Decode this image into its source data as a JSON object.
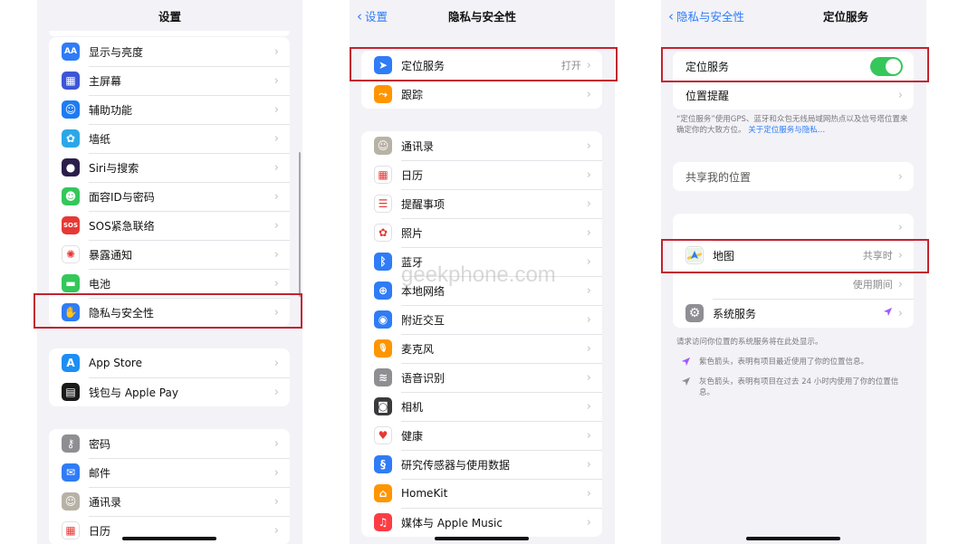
{
  "panel1": {
    "title": "设置",
    "group1": [
      {
        "label": "显示与亮度",
        "icon": "display-brightness-icon",
        "glyph": "AA",
        "color": "#2f7cf6"
      },
      {
        "label": "主屏幕",
        "icon": "home-screen-icon",
        "glyph": "▦",
        "color": "#3d56d6"
      },
      {
        "label": "辅助功能",
        "icon": "accessibility-icon",
        "glyph": "☺",
        "color": "#1e7bf2"
      },
      {
        "label": "墙纸",
        "icon": "wallpaper-icon",
        "glyph": "✿",
        "color": "#2ba7e8"
      },
      {
        "label": "Siri与搜索",
        "icon": "siri-icon",
        "glyph": "●",
        "color": "#2b1f4a"
      },
      {
        "label": "面容ID与密码",
        "icon": "face-id-icon",
        "glyph": "☻",
        "color": "#34c759"
      },
      {
        "label": "SOS紧急联络",
        "icon": "sos-icon",
        "glyph": "SOS",
        "color": "#e53935"
      },
      {
        "label": "暴露通知",
        "icon": "exposure-notification-icon",
        "glyph": "✺",
        "color": "#ffffff"
      },
      {
        "label": "电池",
        "icon": "battery-icon",
        "glyph": "▬",
        "color": "#34c759"
      },
      {
        "label": "隐私与安全性",
        "icon": "privacy-hand-icon",
        "glyph": "✋",
        "color": "#2f7cf6"
      }
    ],
    "group2": [
      {
        "label": "App Store",
        "icon": "app-store-icon",
        "glyph": "A",
        "color": "#1c8ef5"
      },
      {
        "label": "钱包与 Apple Pay",
        "icon": "wallet-icon",
        "glyph": "▤",
        "color": "#1a1a1a"
      }
    ],
    "group3": [
      {
        "label": "密码",
        "icon": "key-icon",
        "glyph": "⚷",
        "color": "#8e8e93"
      },
      {
        "label": "邮件",
        "icon": "mail-icon",
        "glyph": "✉",
        "color": "#2f7cf6"
      },
      {
        "label": "通讯录",
        "icon": "contacts-icon",
        "glyph": "☺",
        "color": "#b8b2a6"
      },
      {
        "label": "日历",
        "icon": "calendar-icon",
        "glyph": "▦",
        "color": "#ffffff"
      }
    ]
  },
  "panel2": {
    "back": "设置",
    "title": "隐私与安全性",
    "group1": [
      {
        "label": "定位服务",
        "value": "打开",
        "icon": "location-arrow-icon",
        "glyph": "➤",
        "color": "#2f7cf6"
      },
      {
        "label": "跟踪",
        "value": "",
        "icon": "tracking-icon",
        "glyph": "⤳",
        "color": "#ff9500"
      }
    ],
    "group2": [
      {
        "label": "通讯录",
        "icon": "contacts-icon",
        "glyph": "☺",
        "color": "#b8b2a6"
      },
      {
        "label": "日历",
        "icon": "calendar-icon",
        "glyph": "▦",
        "color": "#ffffff"
      },
      {
        "label": "提醒事项",
        "icon": "reminders-icon",
        "glyph": "☰",
        "color": "#ffffff"
      },
      {
        "label": "照片",
        "icon": "photos-icon",
        "glyph": "✿",
        "color": "#ffffff"
      },
      {
        "label": "蓝牙",
        "icon": "bluetooth-icon",
        "glyph": "ᛒ",
        "color": "#2f7cf6"
      },
      {
        "label": "本地网络",
        "icon": "local-network-icon",
        "glyph": "⊕",
        "color": "#2f7cf6"
      },
      {
        "label": "附近交互",
        "icon": "nearby-interactions-icon",
        "glyph": "◉",
        "color": "#2f7cf6"
      },
      {
        "label": "麦克风",
        "icon": "microphone-icon",
        "glyph": "🎙",
        "color": "#ff9500"
      },
      {
        "label": "语音识别",
        "icon": "speech-recognition-icon",
        "glyph": "≋",
        "color": "#8e8e93"
      },
      {
        "label": "相机",
        "icon": "camera-icon",
        "glyph": "◙",
        "color": "#3a3a3c"
      },
      {
        "label": "健康",
        "icon": "health-heart-icon",
        "glyph": "♥",
        "color": "#ffffff"
      },
      {
        "label": "研究传感器与使用数据",
        "icon": "research-sensor-icon",
        "glyph": "§",
        "color": "#2f7cf6"
      },
      {
        "label": "HomeKit",
        "icon": "homekit-icon",
        "glyph": "⌂",
        "color": "#ff9500"
      },
      {
        "label": "媒体与 Apple Music",
        "icon": "music-note-icon",
        "glyph": "♫",
        "color": "#fc3c44"
      }
    ],
    "watermark": "geekphone.com"
  },
  "panel3": {
    "back": "隐私与安全性",
    "title": "定位服务",
    "toggle_row": {
      "label": "定位服务",
      "on": true
    },
    "alert_row": {
      "label": "位置提醒"
    },
    "note": "“定位服务”使用GPS、蓝牙和众包无线局域网热点以及信号塔位置来确定你的大致方位。",
    "note_link": "关于定位服务与隐私…",
    "share_row": {
      "label": "共享我的位置"
    },
    "apps": [
      {
        "label": "",
        "value": "",
        "icon": "",
        "color": ""
      },
      {
        "label": "地图",
        "value": "共享时",
        "icon": "maps-icon",
        "glyph": "⬆",
        "color": "#ffffff"
      },
      {
        "label": "",
        "value": "使用期间",
        "icon": "",
        "color": ""
      },
      {
        "label": "系统服务",
        "value": "",
        "icon": "gear-icon",
        "glyph": "⚙",
        "color": "#8e8e93",
        "arrow": "purple"
      }
    ],
    "footer": "请求访问你位置的系统服务将在此处显示。",
    "legend": [
      {
        "text": "紫色箭头，表明有项目最近使用了你的位置信息。",
        "color": "#a259ff"
      },
      {
        "text": "灰色箭头，表明有项目在过去 24 小时内使用了你的位置信息。",
        "color": "#8e8e93"
      }
    ],
    "colors": {
      "accent": "#2f7cf6",
      "toggle_on": "#35c759",
      "highlight": "#c2232f"
    }
  }
}
